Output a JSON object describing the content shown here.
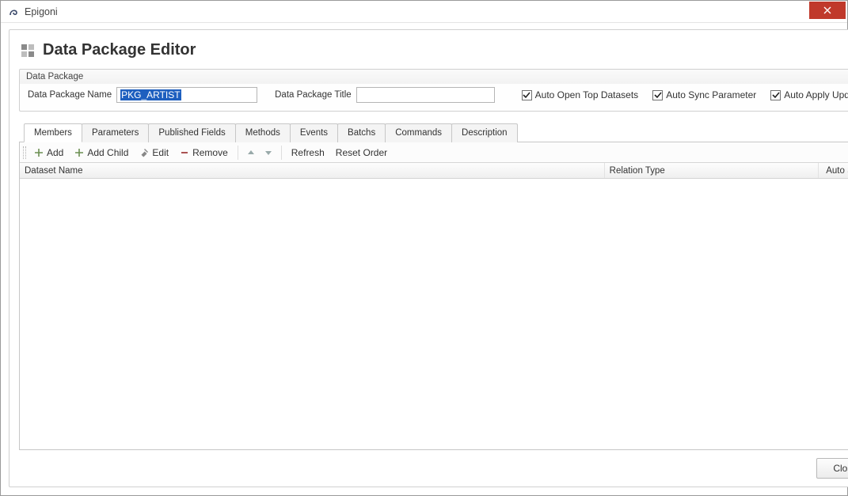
{
  "window": {
    "title": "Epigoni"
  },
  "header": {
    "title": "Data Package Editor"
  },
  "fieldset": {
    "legend": "Data Package",
    "name_label": "Data Package Name",
    "name_value": "PKG_ARTIST",
    "title_label": "Data Package Title",
    "title_value": "",
    "auto_open_label": "Auto Open Top Datasets",
    "auto_open_checked": true,
    "auto_sync_label": "Auto Sync Parameter",
    "auto_sync_checked": true,
    "auto_apply_label": "Auto Apply Updates",
    "auto_apply_checked": true
  },
  "tabs": [
    {
      "label": "Members",
      "active": true
    },
    {
      "label": "Parameters"
    },
    {
      "label": "Published Fields"
    },
    {
      "label": "Methods"
    },
    {
      "label": "Events"
    },
    {
      "label": "Batchs"
    },
    {
      "label": "Commands"
    },
    {
      "label": "Description"
    }
  ],
  "toolbar": {
    "add": "Add",
    "add_child": "Add Child",
    "edit": "Edit",
    "remove": "Remove",
    "refresh": "Refresh",
    "reset_order": "Reset Order"
  },
  "grid": {
    "columns": {
      "dataset": "Dataset Name",
      "relation": "Relation Type",
      "autosync": "Auto Sync"
    }
  },
  "footer": {
    "close": "Close"
  }
}
